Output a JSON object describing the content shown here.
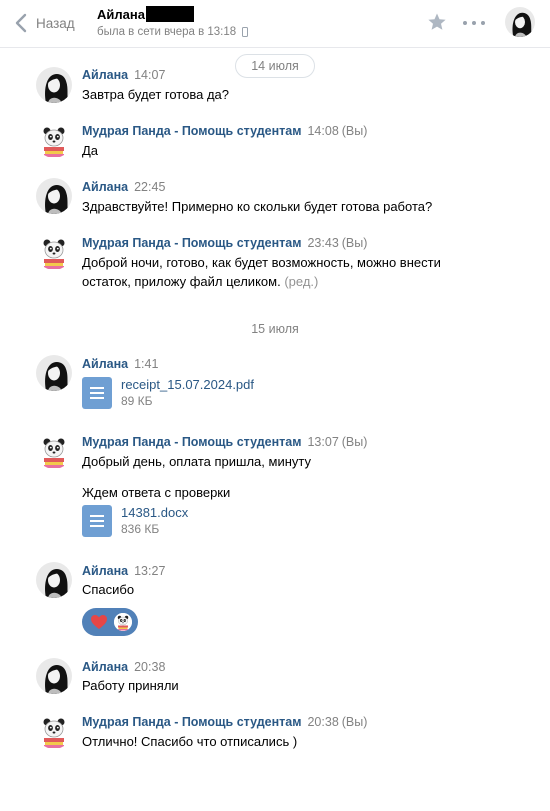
{
  "header": {
    "back_label": "Назад",
    "peer_name": "Айлана",
    "peer_status": "была в сети вчера в 13:18"
  },
  "dates": [
    "14 июля",
    "15 июля"
  ],
  "messages": [
    {
      "author": "Айлана",
      "time": "14:07",
      "text": "Завтра будет готова да?"
    },
    {
      "author": "Мудрая Панда - Помощь студентам",
      "time": "14:08",
      "you": "(Вы)",
      "text": "Да"
    },
    {
      "author": "Айлана",
      "time": "22:45",
      "text": "Здравствуйте! Примерно ко скольки будет готова работа?"
    },
    {
      "author": "Мудрая Панда - Помощь студентам",
      "time": "23:43",
      "you": "(Вы)",
      "text_line1": "Доброй ночи, готово, как будет возможность, можно внести",
      "text_line2": "остаток, приложу файл целиком.",
      "edited": "(ред.)"
    },
    {
      "author": "Айлана",
      "time": "1:41",
      "doc_name": "receipt_15.07.2024.pdf",
      "doc_size": "89 КБ"
    },
    {
      "author": "Мудрая Панда - Помощь студентам",
      "time": "13:07",
      "you": "(Вы)",
      "text": "Добрый день, оплата пришла, минуту",
      "text2": "Ждем ответа с проверки",
      "doc_name": "14381.docx",
      "doc_size": "836 КБ"
    },
    {
      "author": "Айлана",
      "time": "13:27",
      "text": "Спасибо",
      "reaction_icons": [
        "heart-icon",
        "panda-avatar"
      ]
    },
    {
      "author": "Айлана",
      "time": "20:38",
      "text": "Работу приняли"
    },
    {
      "author": "Мудрая Панда - Помощь студентам",
      "time": "20:38",
      "you": "(Вы)",
      "text": "Отлично! Спасибо что отписались )"
    }
  ],
  "icons": {
    "back": "chevron-left-icon",
    "phone": "mobile-phone-icon",
    "star": "star-icon",
    "more": "more-dots-icon",
    "doc": "document-icon"
  },
  "colors": {
    "author_link": "#2a5885",
    "secondary_text": "#828282",
    "doc_icon": "#6f9fd3",
    "reaction_bg": "#5181b8",
    "heart": "#e64646"
  }
}
